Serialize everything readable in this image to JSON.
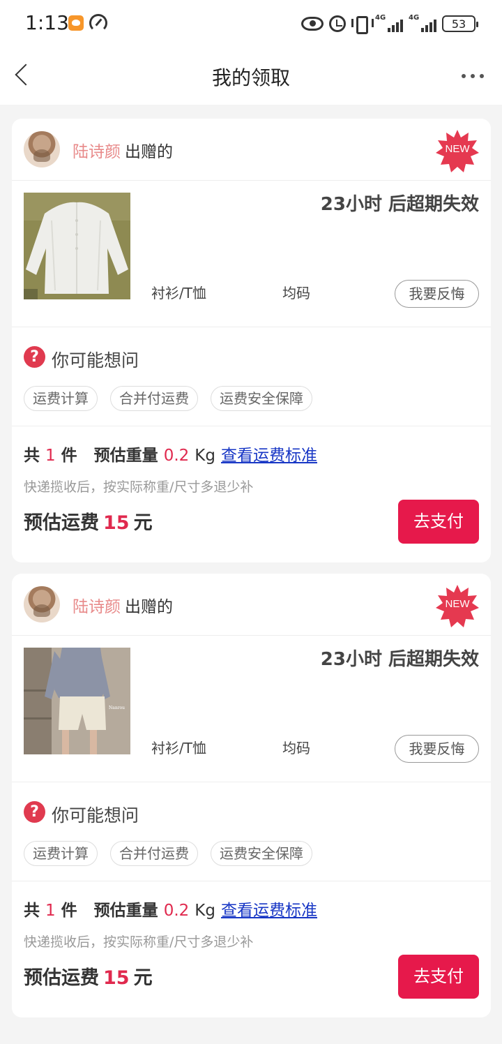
{
  "status_bar": {
    "time": "1:13",
    "signal1_label": "4G",
    "signal2_label": "4G",
    "battery": "53"
  },
  "nav": {
    "title": "我的领取"
  },
  "cards": [
    {
      "donor_name": "陆诗颜",
      "donor_suffix": "出赠的",
      "badge": "NEW",
      "expire": "23小时 后超期失效",
      "category": "衬衫/T恤",
      "size": "均码",
      "regret_label": "我要反悔",
      "faq_title": "你可能想问",
      "tags": [
        "运费计算",
        "合并付运费",
        "运费安全保障"
      ],
      "summary": {
        "count_prefix": "共",
        "count": "1",
        "count_unit": "件",
        "weight_label": "预估重量",
        "weight_value": "0.2",
        "weight_unit": "Kg",
        "link": "查看运费标准",
        "note": "快递揽收后，按实际称重/尺寸多退少补",
        "fee_label": "预估运费",
        "fee_value": "15",
        "fee_unit": "元",
        "pay_label": "去支付"
      }
    },
    {
      "donor_name": "陆诗颜",
      "donor_suffix": "出赠的",
      "badge": "NEW",
      "expire": "23小时 后超期失效",
      "category": "衬衫/T恤",
      "size": "均码",
      "regret_label": "我要反悔",
      "faq_title": "你可能想问",
      "tags": [
        "运费计算",
        "合并付运费",
        "运费安全保障"
      ],
      "summary": {
        "count_prefix": "共",
        "count": "1",
        "count_unit": "件",
        "weight_label": "预估重量",
        "weight_value": "0.2",
        "weight_unit": "Kg",
        "link": "查看运费标准",
        "note": "快递揽收后，按实际称重/尺寸多退少补",
        "fee_label": "预估运费",
        "fee_value": "15",
        "fee_unit": "元",
        "pay_label": "去支付"
      }
    }
  ],
  "colors": {
    "accent": "#e6194b",
    "price_red": "#e0294e",
    "donor_name": "#e88a8a",
    "link_blue": "#1736c5"
  }
}
